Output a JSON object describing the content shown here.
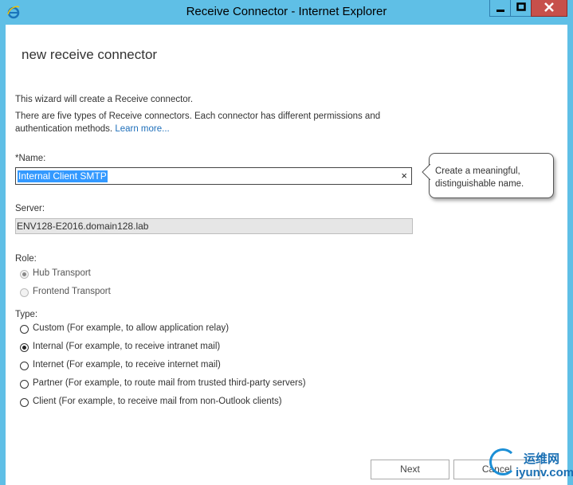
{
  "window": {
    "title": "Receive Connector - Internet Explorer"
  },
  "page": {
    "heading": "new receive connector",
    "intro1": "This wizard will create a Receive connector.",
    "intro2_line1": "There are five types of Receive connectors. Each connector has different permissions and",
    "intro2_line2": "authentication methods. ",
    "learn_more": "Learn more..."
  },
  "name_field": {
    "label": "*Name:",
    "value": "Internal Client SMTP",
    "clear": "×"
  },
  "tooltip": {
    "line1": "Create a meaningful,",
    "line2": "distinguishable name."
  },
  "server_field": {
    "label": "Server:",
    "value": "ENV128-E2016.domain128.lab"
  },
  "role": {
    "label": "Role:",
    "options": [
      {
        "label": "Hub Transport",
        "selected": true
      },
      {
        "label": "Frontend Transport",
        "selected": false
      }
    ]
  },
  "type": {
    "label": "Type:",
    "options": [
      {
        "label": "Custom (For example, to allow application relay)",
        "selected": false
      },
      {
        "label": "Internal (For example, to receive intranet mail)",
        "selected": true
      },
      {
        "label": "Internet (For example, to receive internet mail)",
        "selected": false
      },
      {
        "label": "Partner (For example, to route mail from trusted third-party servers)",
        "selected": false
      },
      {
        "label": "Client (For example, to receive mail from non-Outlook clients)",
        "selected": false
      }
    ]
  },
  "buttons": {
    "next": "Next",
    "cancel": "Cancel"
  },
  "watermark": {
    "cn": "运维网",
    "en": "iyunv.com"
  }
}
